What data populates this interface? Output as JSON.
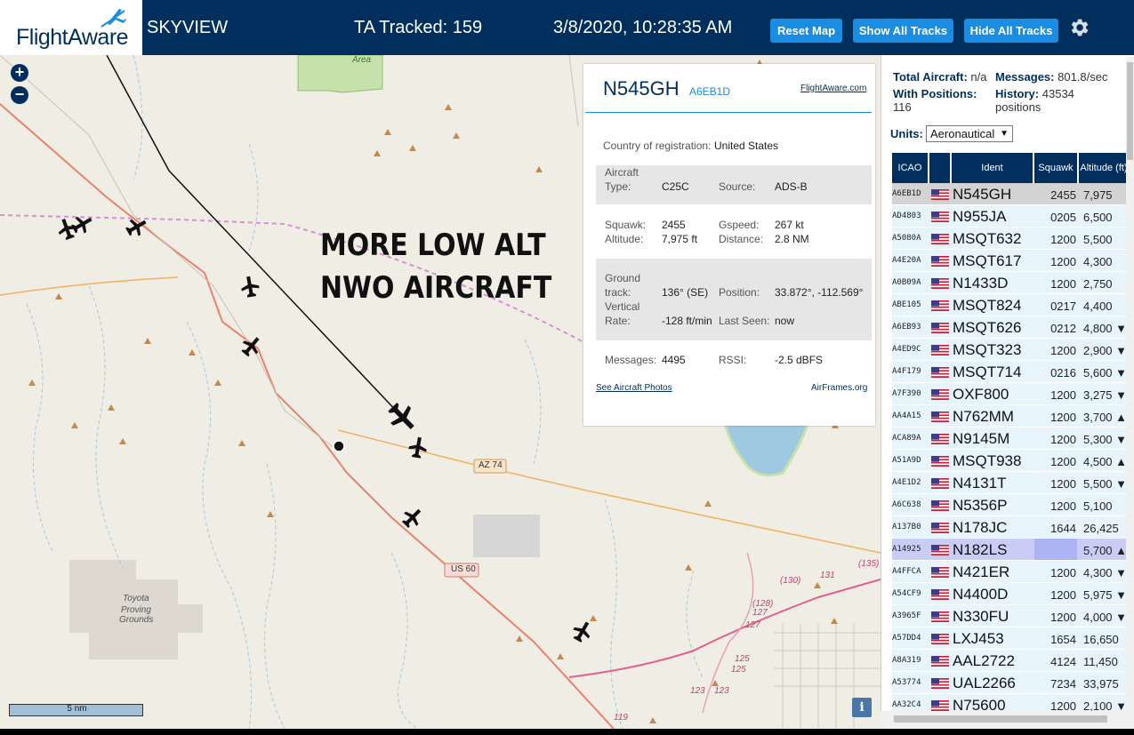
{
  "header": {
    "logo": "FlightAware",
    "title": "SKYVIEW",
    "tracked": "TA Tracked: 159",
    "datetime": "3/8/2020, 10:28:35 AM",
    "buttons": {
      "reset": "Reset Map",
      "show_all": "Show All Tracks",
      "hide_all": "Hide All Tracks"
    },
    "settings_icon": "gear-icon"
  },
  "map": {
    "zoom_in": "+",
    "zoom_out": "−",
    "overlay_line1": "MORE LOW ALT",
    "overlay_line2": "NWO AIRCRAFT",
    "scale": "5 nm",
    "info": "i",
    "labels": {
      "area": "Area",
      "az74": "AZ 74",
      "us60": "US 60",
      "toyota1": "Toyota",
      "toyota2": "Proving",
      "toyota3": "Grounds",
      "r130": "(130)",
      "r131": "131",
      "r135": "(135)",
      "r128": "(128)",
      "r127a": "127",
      "r127b": "127",
      "r125a": "125",
      "r125b": "125",
      "r123a": "123",
      "r123b": "123",
      "r119": "119"
    },
    "colors": {
      "land": "#f0ede4",
      "highway": "#e8826c",
      "state_road": "#f3b15e",
      "boundary": "#d88fd8",
      "water": "#9fc9e0",
      "park": "#c6e1ab"
    }
  },
  "popup": {
    "ident": "N545GH",
    "hex": "A6EB1D",
    "fa_link": "FlightAware.com",
    "country_label": "Country of registration:",
    "country_value": "United States",
    "aircraft_type_label1": "Aircraft",
    "aircraft_type_label2": "Type:",
    "aircraft_type_value": "C25C",
    "source_label": "Source:",
    "source_value": "ADS-B",
    "squawk_label": "Squawk:",
    "squawk_value": "2455",
    "gspeed_label": "Gspeed:",
    "gspeed_value": "267 kt",
    "altitude_label": "Altitude:",
    "altitude_value": "7,975 ft",
    "distance_label": "Distance:",
    "distance_value": "2.8 NM",
    "ground_label1": "Ground",
    "ground_label2": "track:",
    "ground_value": "136° (SE)",
    "position_label": "Position:",
    "position_value": "33.872°, -112.569°",
    "vert_label1": "Vertical",
    "vert_label2": "Rate:",
    "vert_value": "-128 ft/min",
    "lastseen_label": "Last Seen:",
    "lastseen_value": "now",
    "messages_label": "Messages:",
    "messages_value": "4495",
    "rssi_label": "RSSI:",
    "rssi_value": "-2.5 dBFS",
    "photos_link": "See Aircraft Photos",
    "airframes_link": "AirFrames.org"
  },
  "panel": {
    "total_label": "Total Aircraft:",
    "total_value": "n/a",
    "messages_label": "Messages:",
    "messages_value": "801.8/sec",
    "withpos_label": "With Positions:",
    "withpos_value": "116",
    "history_label": "History:",
    "history_value": "43534",
    "history_unit": "positions",
    "units_label": "Units:",
    "units_value": "Aeronautical",
    "columns": [
      "ICAO",
      "Ident",
      "Squawk",
      "Altitude (ft)"
    ],
    "rows": [
      {
        "icao": "A6EB1D",
        "ident": "N545GH",
        "squawk": "2455",
        "alt": "7,975"
      },
      {
        "icao": "AD4803",
        "ident": "N955JA",
        "squawk": "0205",
        "alt": "6,500"
      },
      {
        "icao": "A5080A",
        "ident": "MSQT632",
        "squawk": "1200",
        "alt": "5,500"
      },
      {
        "icao": "A4E20A",
        "ident": "MSQT617",
        "squawk": "1200",
        "alt": "4,300"
      },
      {
        "icao": "A0B09A",
        "ident": "N1433D",
        "squawk": "1200",
        "alt": "2,750"
      },
      {
        "icao": "ABE105",
        "ident": "MSQT824",
        "squawk": "0217",
        "alt": "4,400"
      },
      {
        "icao": "A6EB93",
        "ident": "MSQT626",
        "squawk": "0212",
        "alt": "4,800 ▼"
      },
      {
        "icao": "A4ED9C",
        "ident": "MSQT323",
        "squawk": "1200",
        "alt": "2,900 ▼"
      },
      {
        "icao": "A4F179",
        "ident": "MSQT714",
        "squawk": "0216",
        "alt": "5,600 ▼"
      },
      {
        "icao": "A7F390",
        "ident": "OXF800",
        "squawk": "1200",
        "alt": "3,275 ▼"
      },
      {
        "icao": "AA4A15",
        "ident": "N762MM",
        "squawk": "1200",
        "alt": "3,700 ▲"
      },
      {
        "icao": "ACA89A",
        "ident": "N9145M",
        "squawk": "1200",
        "alt": "5,300 ▼"
      },
      {
        "icao": "A51A9D",
        "ident": "MSQT938",
        "squawk": "1200",
        "alt": "4,500 ▲"
      },
      {
        "icao": "A4E1D2",
        "ident": "N4131T",
        "squawk": "1200",
        "alt": "5,500 ▼"
      },
      {
        "icao": "A6C638",
        "ident": "N5356P",
        "squawk": "1200",
        "alt": "5,100"
      },
      {
        "icao": "A137B0",
        "ident": "N178JC",
        "squawk": "1644",
        "alt": "26,425 ▲"
      },
      {
        "icao": "A14925",
        "ident": "N182LS",
        "squawk": "",
        "alt": "5,700 ▲"
      },
      {
        "icao": "A4FFCA",
        "ident": "N421ER",
        "squawk": "1200",
        "alt": "4,300 ▼"
      },
      {
        "icao": "A54CF9",
        "ident": "N4400D",
        "squawk": "1200",
        "alt": "5,975 ▼"
      },
      {
        "icao": "A3965F",
        "ident": "N330FU",
        "squawk": "1200",
        "alt": "4,000 ▼"
      },
      {
        "icao": "A57DD4",
        "ident": "LXJ453",
        "squawk": "1654",
        "alt": "16,650 ▲"
      },
      {
        "icao": "A8A319",
        "ident": "AAL2722",
        "squawk": "4124",
        "alt": "11,450 ▲"
      },
      {
        "icao": "A53774",
        "ident": "UAL2266",
        "squawk": "7234",
        "alt": "33,975"
      },
      {
        "icao": "AA32C4",
        "ident": "N75600",
        "squawk": "1200",
        "alt": "2,100 ▼"
      }
    ]
  }
}
